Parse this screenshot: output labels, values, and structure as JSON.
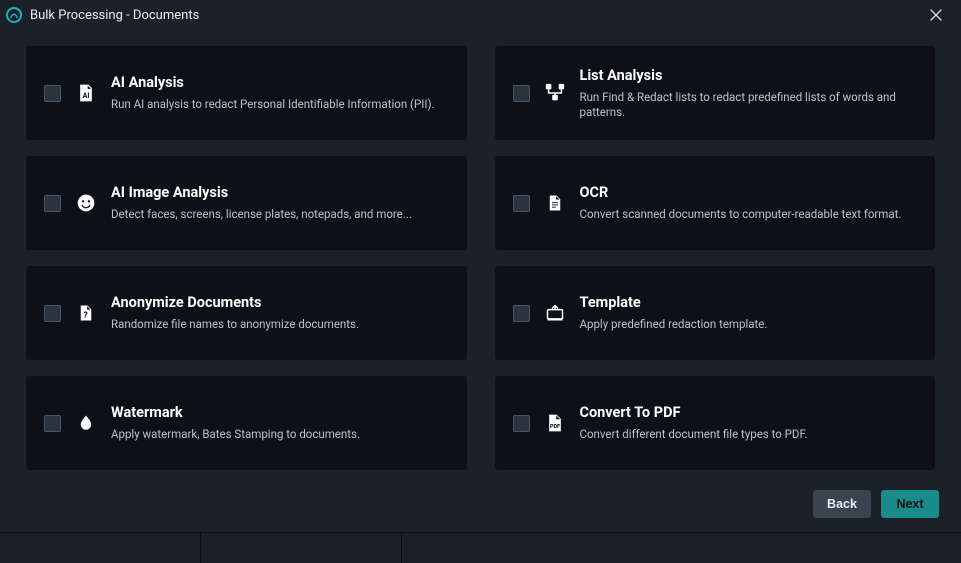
{
  "window": {
    "title": "Bulk Processing - Documents"
  },
  "options": [
    {
      "id": "ai-analysis",
      "title": "AI Analysis",
      "desc": "Run AI analysis to redact Personal Identifiable Information (PII).",
      "checked": false
    },
    {
      "id": "list-analysis",
      "title": "List Analysis",
      "desc": "Run Find & Redact lists to redact predefined lists of words and patterns.",
      "checked": false
    },
    {
      "id": "ai-image-analysis",
      "title": "AI Image Analysis",
      "desc": "Detect faces, screens, license plates, notepads, and more...",
      "checked": false
    },
    {
      "id": "ocr",
      "title": "OCR",
      "desc": "Convert scanned documents to computer-readable text format.",
      "checked": false
    },
    {
      "id": "anonymize-docs",
      "title": "Anonymize Documents",
      "desc": "Randomize file names to anonymize documents.",
      "checked": false
    },
    {
      "id": "template",
      "title": "Template",
      "desc": "Apply predefined redaction template.",
      "checked": false
    },
    {
      "id": "watermark",
      "title": "Watermark",
      "desc": "Apply watermark, Bates Stamping to documents.",
      "checked": false
    },
    {
      "id": "convert-pdf",
      "title": "Convert To PDF",
      "desc": "Convert different document file types to PDF.",
      "checked": false
    }
  ],
  "footer": {
    "back_label": "Back",
    "next_label": "Next"
  }
}
